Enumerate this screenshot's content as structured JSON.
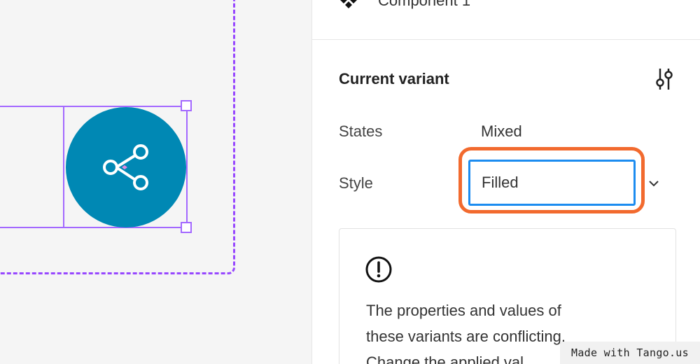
{
  "header": {
    "component_name": "Component 1",
    "component_icon": "component-diamond-icon"
  },
  "current_variant": {
    "title": "Current variant",
    "adjust_icon": "adjust-sliders-icon",
    "properties": [
      {
        "label": "States",
        "value": "Mixed"
      },
      {
        "label": "Style",
        "value": "Filled"
      }
    ],
    "chevron_icon": "chevron-down-icon"
  },
  "warning": {
    "icon": "exclamation-circle-icon",
    "lines": [
      "The properties and values of",
      "these variants are conflicting.",
      "Change the applied val"
    ]
  },
  "canvas": {
    "share_icon": "share-icon",
    "circle_color": "#0088b4",
    "selection_color": "#a368ff",
    "frame_color": "#9747ff"
  },
  "colors": {
    "highlight": "#f26a2e",
    "focus": "#1c8cf0"
  },
  "badge": {
    "text": "Made with Tango.us"
  }
}
